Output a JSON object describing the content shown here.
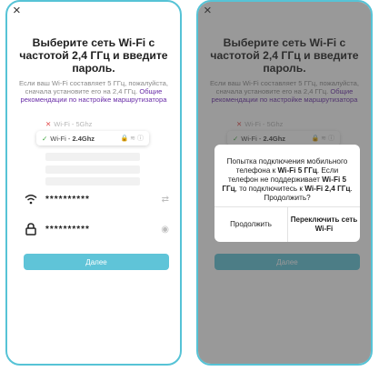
{
  "screen": {
    "close_glyph": "×",
    "title": "Выберите сеть Wi-Fi с частотой 2,4 ГГц и введите пароль.",
    "subtitle_text": "Если ваш Wi-Fi составляет 5 ГГц, пожалуйста, сначала установите его на 2,4 ГГц. ",
    "subtitle_link": "Общие рекомендации по настройке маршрутизатора",
    "networks": [
      {
        "mark": "✕",
        "label": "Wi-Fi - 5Ghz"
      },
      {
        "mark": "✓",
        "label_prefix": "Wi-Fi - ",
        "label_bold": "2.4Ghz",
        "tail": "🔒 ≋ ⓘ"
      }
    ],
    "wifi_field": {
      "value": "**********",
      "right_icon": "⇄"
    },
    "password_field": {
      "value": "**********",
      "right_icon": "◉"
    },
    "next_button": "Далее"
  },
  "dialog": {
    "message_pre": "Попытка подключения мобильного телефона к ",
    "message_b1": "Wi-Fi 5 ГГц",
    "message_mid": ". Если телефон не поддерживает ",
    "message_b2": "Wi-Fi 5 ГГц",
    "message_post": ", то подключитесь к ",
    "message_b3": "Wi-Fi 2,4 ГГц",
    "message_end": ". Продолжить?",
    "continue_button": "Продолжить",
    "switch_button": "Переключить сеть Wi-Fi"
  },
  "colors": {
    "accent": "#5fc4d8",
    "frame": "#56c3d6",
    "link": "#6a2ea8",
    "overlay": "#3c3c3c"
  }
}
